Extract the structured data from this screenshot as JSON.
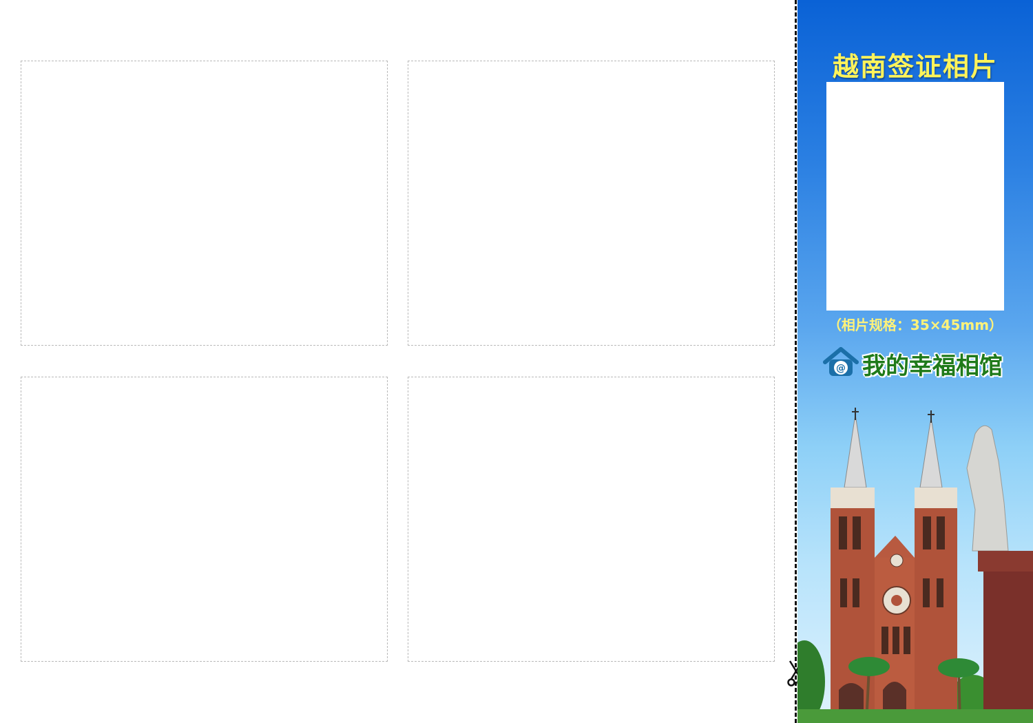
{
  "panel": {
    "title": "越南签证相片",
    "spec": "（相片规格：35×45mm）",
    "brand_name": "我的幸福相馆"
  },
  "icons": {
    "cut": "scissors-icon",
    "brand": "house-at-icon"
  },
  "colors": {
    "panel_top": "#0a62d6",
    "panel_bottom": "#dff2fd",
    "title": "#fff35a",
    "brand_text": "#1f7a1a"
  }
}
